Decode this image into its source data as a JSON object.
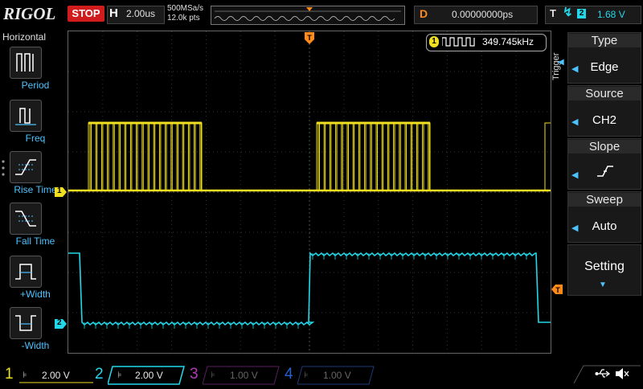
{
  "top": {
    "brand": "RIGOL",
    "run_state": "STOP",
    "timebase_letter": "H",
    "timebase_value": "2.00us",
    "sample_rate": "500MSa/s",
    "mem_depth": "12.0k pts",
    "delay_letter": "D",
    "delay_value": "0.00000000ps",
    "trigger_letter": "T",
    "trigger_channel": "2",
    "trigger_level": "1.68 V"
  },
  "left_menu": {
    "title": "Horizontal",
    "items": [
      {
        "label": "Period"
      },
      {
        "label": "Freq"
      },
      {
        "label": "Rise Time"
      },
      {
        "label": "Fall Time"
      },
      {
        "label": "+Width"
      },
      {
        "label": "-Width"
      }
    ]
  },
  "right_menu": {
    "section": "Trigger",
    "items": [
      {
        "title": "Type",
        "value": "Edge"
      },
      {
        "title": "Source",
        "value": "CH2"
      },
      {
        "title": "Slope",
        "value": ""
      },
      {
        "title": "Sweep",
        "value": "Auto"
      },
      {
        "title": "Setting",
        "value": ""
      }
    ]
  },
  "measurement": {
    "channel": "1",
    "value": "349.745kHz"
  },
  "markers": {
    "ch1": "1",
    "ch2": "2"
  },
  "channels": [
    {
      "num": "1",
      "scale": "2.00 V",
      "color": "#f0e020"
    },
    {
      "num": "2",
      "scale": "2.00 V",
      "color": "#22d8e8"
    },
    {
      "num": "3",
      "scale": "1.00 V",
      "color": "#b23ab8"
    },
    {
      "num": "4",
      "scale": "1.00 V",
      "color": "#2a5fd0"
    }
  ],
  "icons": {
    "usb": "usb-icon",
    "speaker": "speaker-icon"
  }
}
